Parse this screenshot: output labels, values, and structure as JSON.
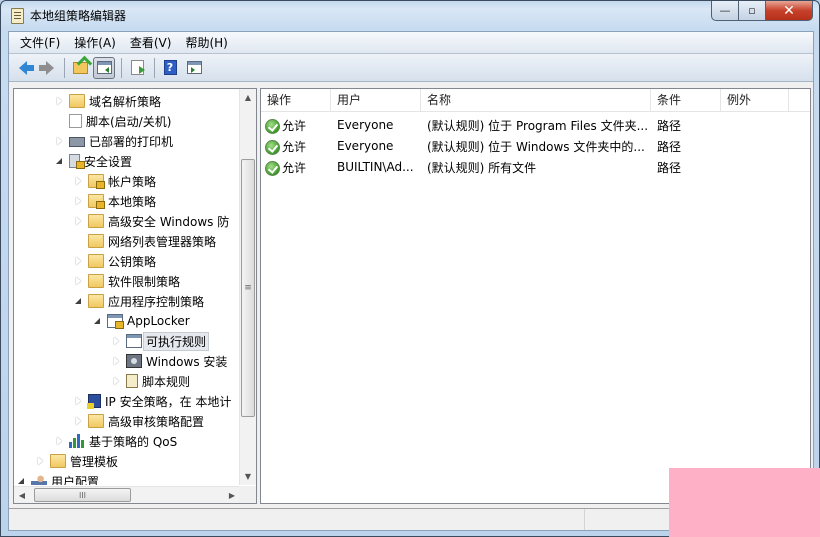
{
  "window": {
    "title": "本地组策略编辑器",
    "controls": {
      "minimize": "—",
      "maximize": "▫",
      "close": "✕"
    }
  },
  "menubar": {
    "items": [
      "文件(F)",
      "操作(A)",
      "查看(V)",
      "帮助(H)"
    ]
  },
  "toolbar": {
    "buttons": [
      {
        "name": "back",
        "icon": "back-arrow-icon"
      },
      {
        "name": "forward",
        "icon": "forward-arrow-icon"
      },
      {
        "name": "up-level",
        "icon": "folder-up-icon"
      },
      {
        "name": "show-hide-console-tree",
        "icon": "console-tree-icon",
        "pressed": true
      },
      {
        "name": "export-list",
        "icon": "export-list-icon"
      },
      {
        "name": "help",
        "icon": "help-icon",
        "glyph": "?"
      },
      {
        "name": "show-hide-action-pane",
        "icon": "action-pane-icon"
      }
    ]
  },
  "tree": {
    "nodes": [
      {
        "label": "域名解析策略",
        "level": 3,
        "expander": "closed",
        "icon": "folder-icon"
      },
      {
        "label": "脚本(启动/关机)",
        "level": 3,
        "expander": "none",
        "icon": "script-icon"
      },
      {
        "label": "已部署的打印机",
        "level": 3,
        "expander": "closed",
        "icon": "printer-icon"
      },
      {
        "label": "安全设置",
        "level": 3,
        "expander": "open",
        "icon": "security-settings-icon"
      },
      {
        "label": "帐户策略",
        "level": 4,
        "expander": "closed",
        "icon": "folder-lock-icon"
      },
      {
        "label": "本地策略",
        "level": 4,
        "expander": "closed",
        "icon": "folder-lock-icon"
      },
      {
        "label": "高级安全 Windows 防",
        "level": 4,
        "expander": "closed",
        "icon": "folder-icon"
      },
      {
        "label": "网络列表管理器策略",
        "level": 4,
        "expander": "none",
        "icon": "folder-icon"
      },
      {
        "label": "公钥策略",
        "level": 4,
        "expander": "closed",
        "icon": "folder-icon"
      },
      {
        "label": "软件限制策略",
        "level": 4,
        "expander": "closed",
        "icon": "folder-icon"
      },
      {
        "label": "应用程序控制策略",
        "level": 4,
        "expander": "open",
        "icon": "folder-icon"
      },
      {
        "label": "AppLocker",
        "level": 5,
        "expander": "open",
        "icon": "applocker-icon"
      },
      {
        "label": "可执行规则",
        "level": 6,
        "expander": "closed",
        "icon": "executable-rules-icon",
        "selected": true
      },
      {
        "label": "Windows 安装",
        "level": 6,
        "expander": "closed",
        "icon": "windows-installer-icon"
      },
      {
        "label": "脚本规则",
        "level": 6,
        "expander": "closed",
        "icon": "script-rules-icon"
      },
      {
        "label": "IP 安全策略，在 本地计",
        "level": 4,
        "expander": "closed",
        "icon": "ip-security-icon"
      },
      {
        "label": "高级审核策略配置",
        "level": 4,
        "expander": "closed",
        "icon": "folder-icon"
      },
      {
        "label": "基于策略的 QoS",
        "level": 3,
        "expander": "closed",
        "icon": "qos-chart-icon"
      },
      {
        "label": "管理模板",
        "level": 2,
        "expander": "closed",
        "icon": "folder-icon"
      },
      {
        "label": "用户配置",
        "level": 1,
        "expander": "open",
        "icon": "user-config-icon"
      }
    ],
    "vscroll_thumb_glyph": "≡",
    "hscroll_thumb_glyph": "III"
  },
  "list": {
    "columns": [
      "操作",
      "用户",
      "名称",
      "条件",
      "例外"
    ],
    "rows": [
      {
        "action": "允许",
        "user": "Everyone",
        "name": "(默认规则) 位于 Program Files 文件夹...",
        "condition": "路径",
        "exception": ""
      },
      {
        "action": "允许",
        "user": "Everyone",
        "name": "(默认规则) 位于 Windows 文件夹中的...",
        "condition": "路径",
        "exception": ""
      },
      {
        "action": "允许",
        "user": "BUILTIN\\Ad...",
        "name": "(默认规则) 所有文件",
        "condition": "路径",
        "exception": ""
      }
    ]
  },
  "statusbar": {
    "text": ""
  },
  "colors": {
    "overlay_pink": "#fdb0c6",
    "allow_green": "#3d9a2a",
    "close_red": "#c7412a"
  }
}
